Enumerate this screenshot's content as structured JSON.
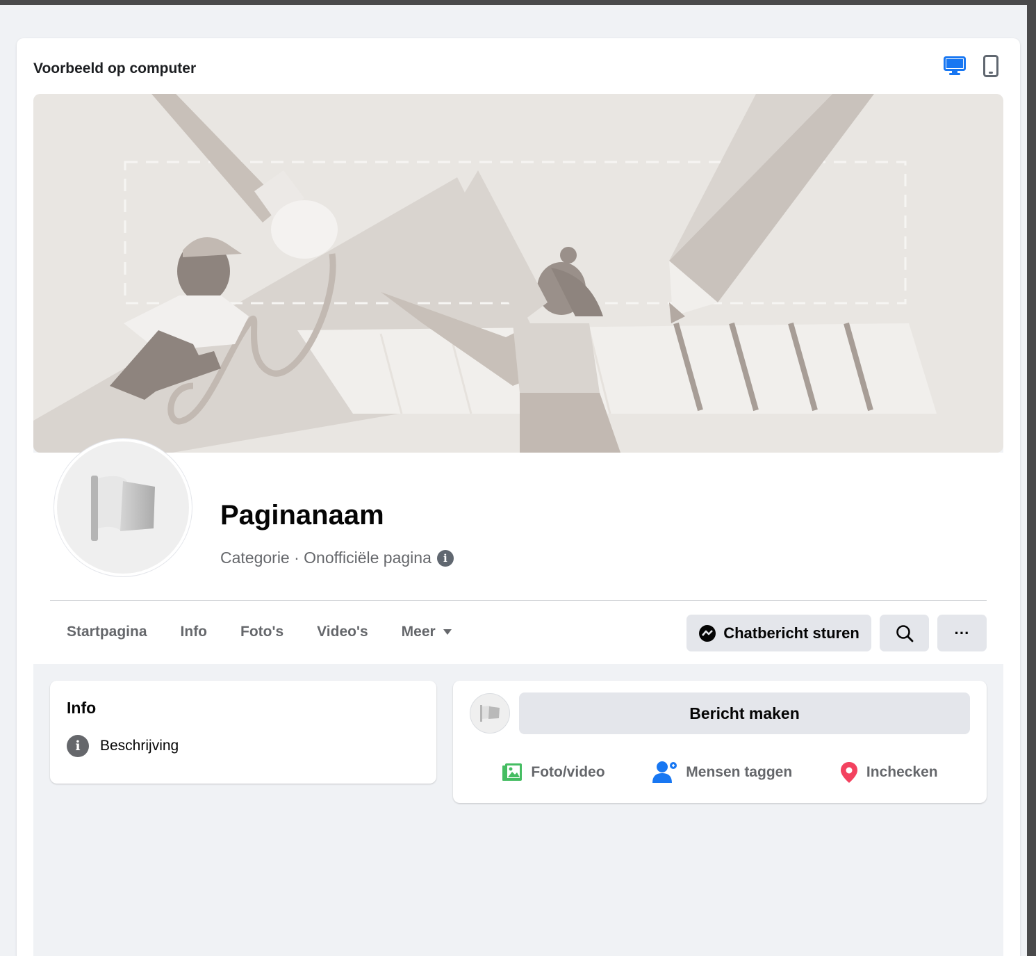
{
  "panel": {
    "title": "Voorbeeld op computer",
    "desktop_icon": "desktop-icon",
    "tablet_icon": "tablet-icon",
    "active_view": "desktop",
    "accent": "#1877f2"
  },
  "page": {
    "name": "Paginanaam",
    "category": "Categorie · Onofficiële pagina",
    "info_glyph": "i"
  },
  "nav": {
    "items": [
      {
        "label": "Startpagina"
      },
      {
        "label": "Info"
      },
      {
        "label": "Foto's"
      },
      {
        "label": "Video's"
      },
      {
        "label": "Meer"
      }
    ],
    "chat_button": "Chatbericht sturen",
    "more_glyph": "···"
  },
  "info_card": {
    "title": "Info",
    "description": "Beschrijving",
    "info_glyph": "i"
  },
  "post_card": {
    "compose": "Bericht maken",
    "actions": [
      {
        "label": "Foto/video",
        "icon": "photo-video-icon",
        "color": "#45bd62"
      },
      {
        "label": "Mensen taggen",
        "icon": "tag-people-icon",
        "color": "#1877f2"
      },
      {
        "label": "Inchecken",
        "icon": "check-in-icon",
        "color": "#f3425f"
      }
    ]
  }
}
